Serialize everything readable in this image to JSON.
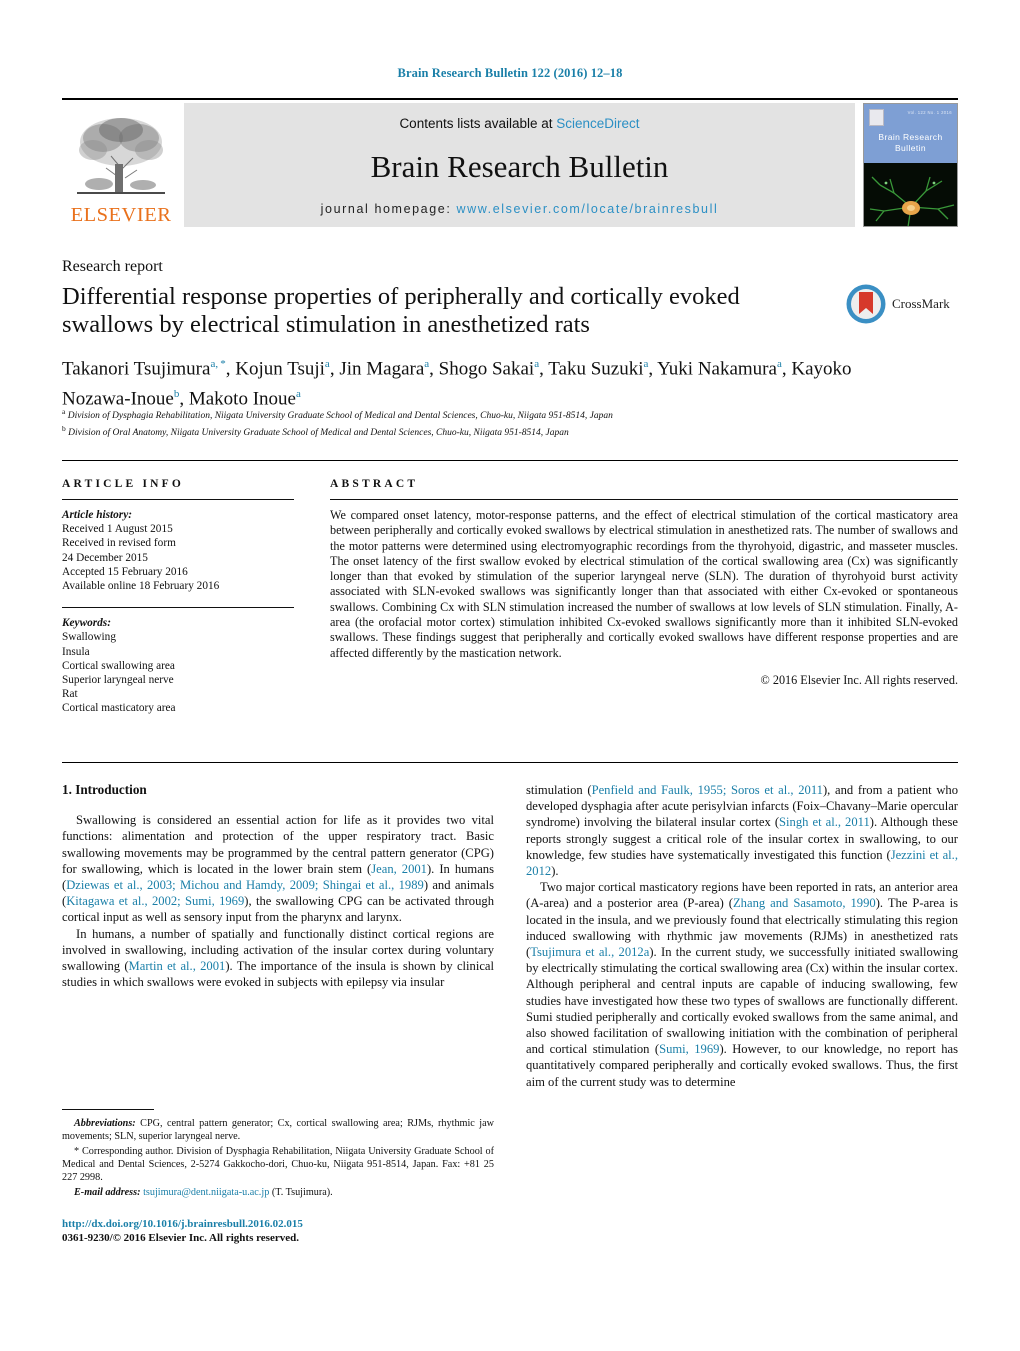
{
  "running_head": "Brain Research Bulletin 122 (2016) 12–18",
  "masthead": {
    "contents_prefix": "Contents lists available at ",
    "sciencedirect": "ScienceDirect",
    "journal_title": "Brain Research Bulletin",
    "homepage_prefix": "journal homepage: ",
    "homepage_url": "www.elsevier.com/locate/brainresbull",
    "publisher_wordmark": "ELSEVIER",
    "cover_title_line1": "Brain Research",
    "cover_title_line2": "Bulletin",
    "cover_issue": "Vol. 122  No. 1  2016"
  },
  "article": {
    "kicker": "Research report",
    "title": "Differential response properties of peripherally and cortically evoked swallows by electrical stimulation in anesthetized rats",
    "crossmark_label": "CrossMark",
    "authors_line1": "Takanori Tsujimura",
    "authors_html": "Takanori Tsujimura<sup>a, *</sup>, Kojun Tsuji<sup>a</sup>, Jin Magara<sup>a</sup>, Shogo Sakai<sup>a</sup>, Taku Suzuki<sup>a</sup>, Yuki Nakamura<sup>a</sup>, Kayoko Nozawa-Inoue<sup>b</sup>, Makoto Inoue<sup>a</sup>",
    "affiliation_a": "Division of Dysphagia Rehabilitation, Niigata University Graduate School of Medical and Dental Sciences, Chuo-ku, Niigata 951-8514, Japan",
    "affiliation_b": "Division of Oral Anatomy, Niigata University Graduate School of Medical and Dental Sciences, Chuo-ku, Niigata 951-8514, Japan"
  },
  "info": {
    "header": "ARTICLE INFO",
    "history_label": "Article history:",
    "history": [
      "Received 1 August 2015",
      "Received in revised form",
      "24 December 2015",
      "Accepted 15 February 2016",
      "Available online 18 February 2016"
    ],
    "keywords_label": "Keywords:",
    "keywords": [
      "Swallowing",
      "Insula",
      "Cortical swallowing area",
      "Superior laryngeal nerve",
      "Rat",
      "Cortical masticatory area"
    ]
  },
  "abstract": {
    "header": "ABSTRACT",
    "text": "We compared onset latency, motor-response patterns, and the effect of electrical stimulation of the cortical masticatory area between peripherally and cortically evoked swallows by electrical stimulation in anesthetized rats. The number of swallows and the motor patterns were determined using electromyographic recordings from the thyrohyoid, digastric, and masseter muscles. The onset latency of the first swallow evoked by electrical stimulation of the cortical swallowing area (Cx) was significantly longer than that evoked by stimulation of the superior laryngeal nerve (SLN). The duration of thyrohyoid burst activity associated with SLN-evoked swallows was significantly longer than that associated with either Cx-evoked or spontaneous swallows. Combining Cx with SLN stimulation increased the number of swallows at low levels of SLN stimulation. Finally, A-area (the orofacial motor cortex) stimulation inhibited Cx-evoked swallows significantly more than it inhibited SLN-evoked swallows. These findings suggest that peripherally and cortically evoked swallows have different response properties and are affected differently by the mastication network.",
    "copyright": "© 2016 Elsevier Inc. All rights reserved."
  },
  "introduction": {
    "heading": "1. Introduction",
    "left_paragraphs": [
      {
        "runs": [
          {
            "t": "Swallowing is considered an essential action for life as it provides two vital functions: alimentation and protection of the upper respiratory tract. Basic swallowing movements may be programmed by the central pattern generator (CPG) for swallowing, which is located in the lower brain stem ("
          },
          {
            "t": "Jean, 2001",
            "ref": true
          },
          {
            "t": "). In humans ("
          },
          {
            "t": "Dziewas et al., 2003; Michou and Hamdy, 2009; Shingai et al., 1989",
            "ref": true
          },
          {
            "t": ") and animals ("
          },
          {
            "t": "Kitagawa et al., 2002; Sumi, 1969",
            "ref": true
          },
          {
            "t": "), the swallowing CPG can be activated through cortical input as well as sensory input from the pharynx and larynx."
          }
        ]
      },
      {
        "runs": [
          {
            "t": "In humans, a number of spatially and functionally distinct cortical regions are involved in swallowing, including activation of the insular cortex during voluntary swallowing ("
          },
          {
            "t": "Martin et al., 2001",
            "ref": true
          },
          {
            "t": "). The importance of the insula is shown by clinical studies in which swallows were evoked in subjects with epilepsy via insular"
          }
        ]
      }
    ],
    "right_paragraphs": [
      {
        "noindent": true,
        "runs": [
          {
            "t": "stimulation ("
          },
          {
            "t": "Penfield and Faulk, 1955; Soros et al., 2011",
            "ref": true
          },
          {
            "t": "), and from a patient who developed dysphagia after acute perisylvian infarcts (Foix–Chavany–Marie opercular syndrome) involving the bilateral insular cortex ("
          },
          {
            "t": "Singh et al., 2011",
            "ref": true
          },
          {
            "t": "). Although these reports strongly suggest a critical role of the insular cortex in swallowing, to our knowledge, few studies have systematically investigated this function ("
          },
          {
            "t": "Jezzini et al., 2012",
            "ref": true
          },
          {
            "t": ")."
          }
        ]
      },
      {
        "runs": [
          {
            "t": "Two major cortical masticatory regions have been reported in rats, an anterior area (A-area) and a posterior area (P-area) ("
          },
          {
            "t": "Zhang and Sasamoto, 1990",
            "ref": true
          },
          {
            "t": "). The P-area is located in the insula, and we previously found that electrically stimulating this region induced swallowing with rhythmic jaw movements (RJMs) in anesthetized rats ("
          },
          {
            "t": "Tsujimura et al., 2012a",
            "ref": true
          },
          {
            "t": "). In the current study, we successfully initiated swallowing by electrically stimulating the cortical swallowing area (Cx) within the insular cortex. Although peripheral and central inputs are capable of inducing swallowing, few studies have investigated how these two types of swallows are functionally different. Sumi studied peripherally and cortically evoked swallows from the same animal, and also showed facilitation of swallowing initiation with the combination of peripheral and cortical stimulation ("
          },
          {
            "t": "Sumi, 1969",
            "ref": true
          },
          {
            "t": "). However, to our knowledge, no report has quantitatively compared peripherally and cortically evoked swallows. Thus, the first aim of the current study was to determine"
          }
        ]
      }
    ]
  },
  "footnotes": {
    "abbreviations_label": "Abbreviations:",
    "abbreviations_text": " CPG, central pattern generator; Cx, cortical swallowing area; RJMs, rhythmic jaw movements; SLN, superior laryngeal nerve.",
    "corresponding": "* Corresponding author. Division of Dysphagia Rehabilitation, Niigata University Graduate School of Medical and Dental Sciences, 2-5274 Gakkocho-dori, Chuo-ku, Niigata 951-8514, Japan. Fax: +81 25 227 2998.",
    "email_label": "E-mail address:",
    "email": "tsujimura@dent.niigata-u.ac.jp",
    "email_suffix": " (T. Tsujimura)."
  },
  "doi_block": {
    "doi": "http://dx.doi.org/10.1016/j.brainresbull.2016.02.015",
    "issn_line": "0361-9230/© 2016 Elsevier Inc. All rights reserved."
  },
  "colors": {
    "link": "#1a7fa8",
    "sciencedirect": "#2b8fc4",
    "elsevier_orange": "#E9711C",
    "masthead_grey": "#e3e3e3",
    "cover_blue": "#7e9fd4"
  }
}
